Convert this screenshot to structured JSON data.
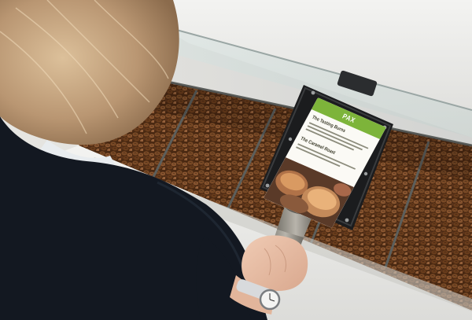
{
  "scene": {
    "description_tags": [
      "person",
      "coffee-beans",
      "tablet-kiosk",
      "handheld-scanner",
      "wristwatch"
    ],
    "colors": {
      "beans": "#6b3e1f",
      "counter": "#e9e9e6",
      "screen_accent": "#7db43a",
      "sweater": "#151a24",
      "hair": "#c9a882"
    }
  },
  "tablet": {
    "header_text": "PAX",
    "sections": [
      {
        "heading": "The Tasting Burns",
        "body": ""
      },
      {
        "heading": "The Caramel Roast",
        "body": ""
      }
    ]
  }
}
